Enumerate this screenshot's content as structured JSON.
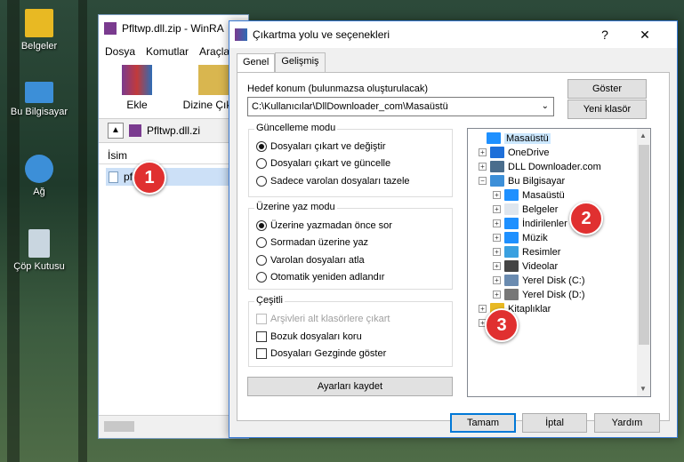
{
  "desktop": {
    "icons": [
      {
        "label": "Belgeler",
        "icon": "folder-icon",
        "color": "#e8b923"
      },
      {
        "label": "Bu Bilgisayar",
        "icon": "computer-icon",
        "color": "#3c8fd8"
      },
      {
        "label": "Ağ",
        "icon": "network-icon",
        "color": "#3c8fd8"
      },
      {
        "label": "Çöp Kutusu",
        "icon": "recycle-bin-icon",
        "color": "#c9d6e0"
      }
    ]
  },
  "winrar": {
    "title": "Pfltwp.dll.zip - WinRA",
    "menu": [
      "Dosya",
      "Komutlar",
      "Araçlar"
    ],
    "toolbar": [
      {
        "label": "Ekle",
        "icon": "add-archive-icon"
      },
      {
        "label": "Dizine Çıkart",
        "icon": "extract-to-icon"
      }
    ],
    "path": "Pfltwp.dll.zi",
    "column_header": "İsim",
    "file_row": "pfltwp.dll"
  },
  "dialog": {
    "title": "Çıkartma yolu ve seçenekleri",
    "help_symbol": "?",
    "close_symbol": "✕",
    "tabs": [
      "Genel",
      "Gelişmiş"
    ],
    "dest_label": "Hedef konum (bulunmazsa oluşturulacak)",
    "dest_value": "C:\\Kullanıcılar\\DllDownloader_com\\Masaüstü",
    "show_button": "Göster",
    "new_folder_button": "Yeni klasör",
    "update_mode": {
      "title": "Güncelleme modu",
      "options": [
        "Dosyaları çıkart ve değiştir",
        "Dosyaları çıkart ve güncelle",
        "Sadece varolan dosyaları tazele"
      ],
      "selected": 0
    },
    "overwrite_mode": {
      "title": "Üzerine yaz modu",
      "options": [
        "Üzerine yazmadan önce sor",
        "Sormadan üzerine yaz",
        "Varolan dosyaları atla",
        "Otomatik yeniden adlandır"
      ],
      "selected": 0
    },
    "misc": {
      "title": "Çeşitli",
      "options": [
        {
          "label": "Arşivleri alt klasörlere çıkart",
          "disabled": true
        },
        {
          "label": "Bozuk dosyaları koru",
          "disabled": false
        },
        {
          "label": "Dosyaları Gezginde göster",
          "disabled": false
        }
      ]
    },
    "save_settings_button": "Ayarları kaydet",
    "tree": [
      {
        "label": "Masaüstü",
        "icon": "desktop-folder-icon",
        "color": "#1e90ff",
        "indent": 0,
        "expander": "",
        "selected": true
      },
      {
        "label": "OneDrive",
        "icon": "onedrive-icon",
        "color": "#1e6fd9",
        "indent": 1,
        "expander": "+"
      },
      {
        "label": "DLL Downloader.com",
        "icon": "user-icon",
        "color": "#4a6d8c",
        "indent": 1,
        "expander": "+"
      },
      {
        "label": "Bu Bilgisayar",
        "icon": "computer-icon",
        "color": "#3c8fd8",
        "indent": 1,
        "expander": "−"
      },
      {
        "label": "Masaüstü",
        "icon": "desktop-folder-icon",
        "color": "#1e90ff",
        "indent": 2,
        "expander": "+"
      },
      {
        "label": "Belgeler",
        "icon": "documents-icon",
        "color": "#dfe6ee",
        "indent": 2,
        "expander": "+"
      },
      {
        "label": "İndirilenler",
        "icon": "downloads-icon",
        "color": "#1e90ff",
        "indent": 2,
        "expander": "+"
      },
      {
        "label": "Müzik",
        "icon": "music-icon",
        "color": "#1e90ff",
        "indent": 2,
        "expander": "+"
      },
      {
        "label": "Resimler",
        "icon": "pictures-icon",
        "color": "#3aa0e0",
        "indent": 2,
        "expander": "+"
      },
      {
        "label": "Videolar",
        "icon": "videos-icon",
        "color": "#444444",
        "indent": 2,
        "expander": "+"
      },
      {
        "label": "Yerel Disk (C:)",
        "icon": "drive-icon",
        "color": "#6a8bb0",
        "indent": 2,
        "expander": "+"
      },
      {
        "label": "Yerel Disk (D:)",
        "icon": "drive-icon",
        "color": "#777777",
        "indent": 2,
        "expander": "+"
      },
      {
        "label": "Kitaplıklar",
        "icon": "libraries-icon",
        "color": "#e8b923",
        "indent": 1,
        "expander": "+"
      },
      {
        "label": "",
        "icon": "folder-icon",
        "color": "#e8b923",
        "indent": 1,
        "expander": "+"
      }
    ],
    "ok_button": "Tamam",
    "cancel_button": "İptal",
    "help_button": "Yardım"
  },
  "annotations": [
    "1",
    "2",
    "3"
  ],
  "colors": {
    "accent": "#0078d7",
    "annotation": "#e03030",
    "selection": "#cce8ff"
  }
}
